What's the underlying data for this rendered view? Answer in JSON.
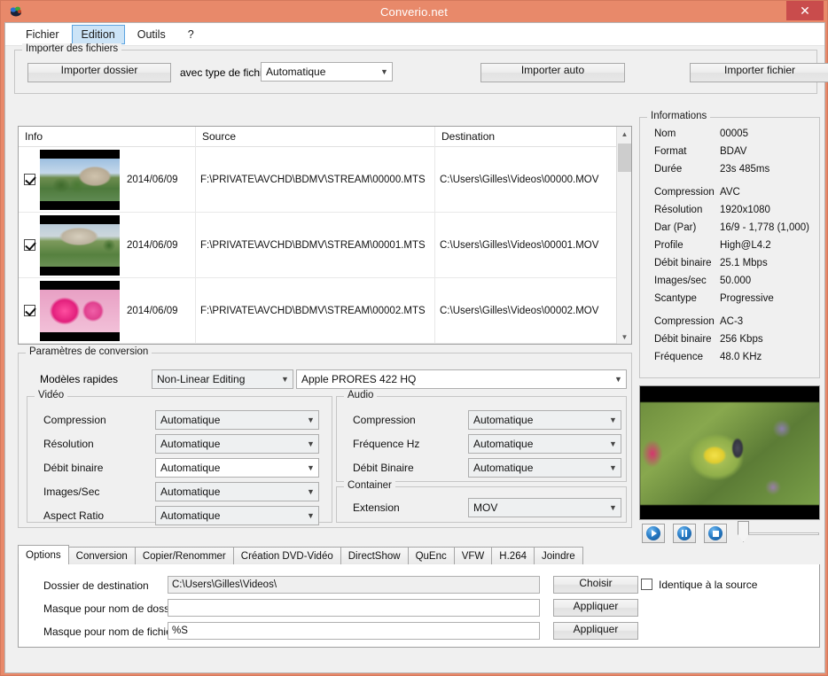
{
  "window": {
    "title": "Converio.net",
    "close_label": "✕",
    "titlebar_color": "#e8896a",
    "close_color": "#c94c4c"
  },
  "menu": {
    "items": [
      {
        "label": "Fichier",
        "active": false
      },
      {
        "label": "Edition",
        "active": true
      },
      {
        "label": "Outils",
        "active": false
      },
      {
        "label": "?",
        "active": false
      }
    ]
  },
  "import": {
    "legend": "Importer des fichiers",
    "import_folder_label": "Importer dossier",
    "file_type_label": "avec type de fichier",
    "file_type_value": "Automatique",
    "import_auto_label": "Importer auto",
    "import_file_label": "Importer fichier"
  },
  "filelist": {
    "columns": [
      "Info",
      "Source",
      "Destination"
    ],
    "rows": [
      {
        "checked": true,
        "thumb": "castle-fountain",
        "date": "2014/06/09",
        "source": "F:\\PRIVATE\\AVCHD\\BDMV\\STREAM\\00000.MTS",
        "destination": "C:\\Users\\Gilles\\Videos\\00000.MOV"
      },
      {
        "checked": true,
        "thumb": "castle-garden",
        "date": "2014/06/09",
        "source": "F:\\PRIVATE\\AVCHD\\BDMV\\STREAM\\00001.MTS",
        "destination": "C:\\Users\\Gilles\\Videos\\00001.MOV"
      },
      {
        "checked": true,
        "thumb": "pink-rose",
        "date": "2014/06/09",
        "source": "F:\\PRIVATE\\AVCHD\\BDMV\\STREAM\\00002.MTS",
        "destination": "C:\\Users\\Gilles\\Videos\\00002.MOV"
      }
    ]
  },
  "conversion": {
    "legend": "Paramètres de conversion",
    "templates_label": "Modèles rapides",
    "template_category": "Non-Linear Editing",
    "template_preset": "Apple PRORES 422 HQ",
    "video": {
      "legend": "Vidéo",
      "fields": [
        {
          "label": "Compression",
          "value": "Automatique"
        },
        {
          "label": "Résolution",
          "value": "Automatique"
        },
        {
          "label": "Débit binaire",
          "value": "Automatique"
        },
        {
          "label": "Images/Sec",
          "value": "Automatique"
        },
        {
          "label": "Aspect Ratio",
          "value": "Automatique"
        }
      ]
    },
    "audio": {
      "legend": "Audio",
      "fields": [
        {
          "label": "Compression",
          "value": "Automatique"
        },
        {
          "label": "Fréquence Hz",
          "value": "Automatique"
        },
        {
          "label": "Débit Binaire",
          "value": "Automatique"
        }
      ]
    },
    "container": {
      "legend": "Container",
      "fields": [
        {
          "label": "Extension",
          "value": "MOV"
        }
      ]
    }
  },
  "informations": {
    "legend": "Informations",
    "rows": [
      {
        "key": "Nom",
        "value": "00005"
      },
      {
        "key": "Format",
        "value": "BDAV"
      },
      {
        "key": "Durée",
        "value": "23s 485ms"
      },
      {
        "key": "",
        "value": ""
      },
      {
        "key": "Compression",
        "value": "AVC"
      },
      {
        "key": "Résolution",
        "value": "1920x1080"
      },
      {
        "key": "Dar (Par)",
        "value": "16/9 - 1,778 (1,000)"
      },
      {
        "key": "Profile",
        "value": "High@L4.2"
      },
      {
        "key": "Débit binaire",
        "value": "25.1 Mbps"
      },
      {
        "key": "Images/sec",
        "value": "50.000"
      },
      {
        "key": "Scantype",
        "value": "Progressive"
      },
      {
        "key": "",
        "value": ""
      },
      {
        "key": "Compression",
        "value": "AC-3"
      },
      {
        "key": "Débit binaire",
        "value": "256 Kbps"
      },
      {
        "key": "Fréquence",
        "value": "48.0 KHz"
      }
    ]
  },
  "player": {
    "play_icon": "play-icon",
    "pause_icon": "pause-icon",
    "stop_icon": "stop-icon"
  },
  "tabs": [
    {
      "label": "Options",
      "active": true
    },
    {
      "label": "Conversion",
      "active": false
    },
    {
      "label": "Copier/Renommer",
      "active": false
    },
    {
      "label": "Création DVD-Vidéo",
      "active": false
    },
    {
      "label": "DirectShow",
      "active": false
    },
    {
      "label": "QuEnc",
      "active": false
    },
    {
      "label": "VFW",
      "active": false
    },
    {
      "label": "H.264",
      "active": false
    },
    {
      "label": "Joindre",
      "active": false
    }
  ],
  "options_tab": {
    "dest_folder_label": "Dossier de destination",
    "dest_folder_value": "C:\\Users\\Gilles\\Videos\\",
    "choose_label": "Choisir",
    "same_as_source_label": "Identique à la source",
    "same_as_source_checked": false,
    "folder_mask_label": "Masque pour nom de dossiers",
    "folder_mask_value": "",
    "folder_mask_apply": "Appliquer",
    "file_mask_label": "Masque pour nom de fichiers",
    "file_mask_value": "%S",
    "file_mask_apply": "Appliquer"
  }
}
